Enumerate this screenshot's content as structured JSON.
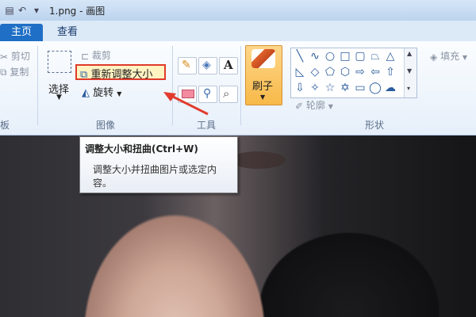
{
  "window": {
    "title": "1.png - 画图"
  },
  "tabs": [
    {
      "label": "主页"
    },
    {
      "label": "查看"
    }
  ],
  "clipboard": {
    "cut": "剪切",
    "copy": "复制",
    "group": "板"
  },
  "image": {
    "select": "选择",
    "crop": "裁剪",
    "resize": "重新调整大小",
    "rotate": "旋转",
    "group": "图像"
  },
  "tools": {
    "group": "工具",
    "text_tool": "A"
  },
  "brushes": {
    "label": "刷子"
  },
  "shapes": {
    "outline": "轮廓",
    "fill": "填充",
    "group": "形状"
  },
  "tooltip": {
    "title": "调整大小和扭曲(Ctrl+W)",
    "desc": "调整大小并扭曲图片或选定内容。"
  },
  "colors": {
    "accent": "#1f6fc6",
    "highlight_border": "#e03a2a",
    "arrow": "#e23b2e"
  }
}
